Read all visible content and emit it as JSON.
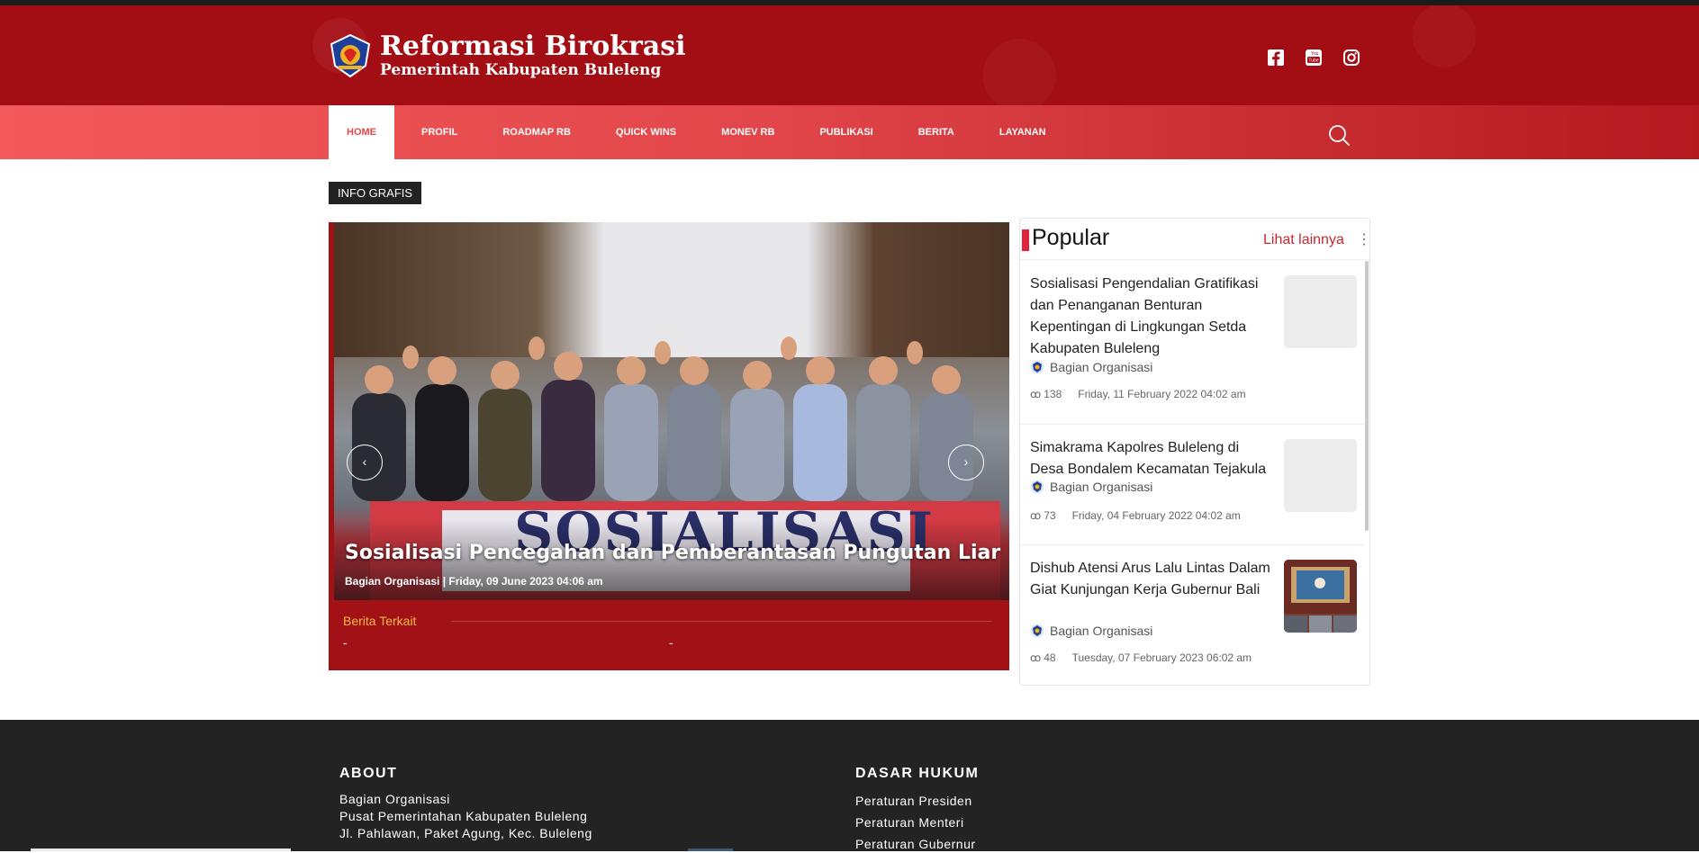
{
  "brand": {
    "title": "Reformasi Birokrasi",
    "subtitle": "Pemerintah Kabupaten Buleleng",
    "colors": {
      "header": "#a30d14",
      "nav_start": "#f2595a",
      "nav_end": "#b3191e",
      "accent": "#e2233c"
    }
  },
  "social": [
    "facebook-icon",
    "youtube-icon",
    "instagram-icon"
  ],
  "nav": {
    "items": [
      {
        "label": "HOME",
        "active": true
      },
      {
        "label": "PROFIL"
      },
      {
        "label": "ROADMAP RB"
      },
      {
        "label": "QUICK WINS"
      },
      {
        "label": "MONEV RB"
      },
      {
        "label": "PUBLIKASI"
      },
      {
        "label": "BERITA"
      },
      {
        "label": "LAYANAN"
      }
    ],
    "search_icon": "search-icon"
  },
  "section_badge": "INFO GRAFIS",
  "slider": {
    "banner_word": "SOSIALISASI",
    "title": "Sosialisasi Pencegahan dan Pemberantasan Pungutan Liar",
    "meta": "Bagian Organisasi | Friday, 09 June 2023 04:06 am",
    "prev": "‹",
    "next": "›",
    "related_label": "Berita Terkait",
    "related_items": [
      "-",
      "-"
    ]
  },
  "popular": {
    "title": "Popular",
    "more": "Lihat lainnya",
    "menu": "⋮",
    "items": [
      {
        "title": "Sosialisasi Pengendalian Gratifikasi dan Penanganan Benturan Kepentingan di Lingkungan Setda Kabupaten Buleleng",
        "author": "Bagian Organisasi",
        "views": "138",
        "date": "Friday, 11 February 2022 04:02 am"
      },
      {
        "title": "Simakrama Kapolres Buleleng di Desa Bondalem Kecamatan Tejakula",
        "author": "Bagian Organisasi",
        "views": "73",
        "date": "Friday, 04 February 2022 04:02 am"
      },
      {
        "title": "Dishub Atensi Arus Lalu Lintas Dalam Giat Kunjungan Kerja Gubernur Bali",
        "author": "Bagian Organisasi",
        "views": "48",
        "date": "Tuesday, 07 February 2023 06:02 am"
      }
    ]
  },
  "footer": {
    "about_heading": "ABOUT",
    "about_lines": [
      "Bagian Organisasi",
      "Pusat Pemerintahan Kabupaten Buleleng",
      "Jl. Pahlawan, Paket Agung, Kec. Buleleng"
    ],
    "legal_heading": "DASAR HUKUM",
    "legal_links": [
      "Peraturan Presiden",
      "Peraturan Menteri",
      "Peraturan Gubernur"
    ]
  }
}
